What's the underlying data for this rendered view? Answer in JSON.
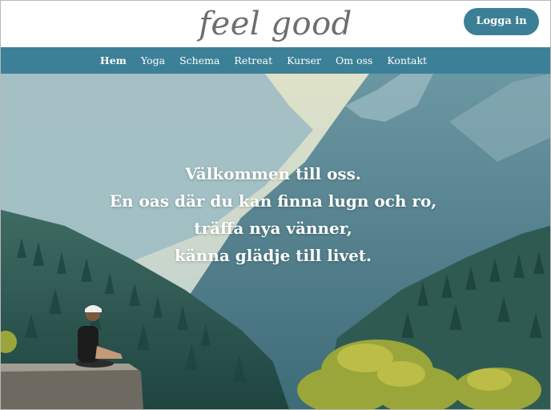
{
  "header": {
    "logo": "feel good",
    "login_label": "Logga in"
  },
  "nav": {
    "items": [
      {
        "label": "Hem",
        "active": true
      },
      {
        "label": "Yoga"
      },
      {
        "label": "Schema"
      },
      {
        "label": "Retreat"
      },
      {
        "label": "Kurser"
      },
      {
        "label": "Om oss"
      },
      {
        "label": "Kontakt"
      }
    ]
  },
  "hero": {
    "lines": [
      "Välkommen till oss.",
      "En oas där du kan finna lugn och ro,",
      "träffa nya vänner,",
      "känna glädje till livet."
    ]
  },
  "colors": {
    "brand": "#3b8097",
    "button": "#3b7f96",
    "logo_text": "#6e6e6e"
  }
}
